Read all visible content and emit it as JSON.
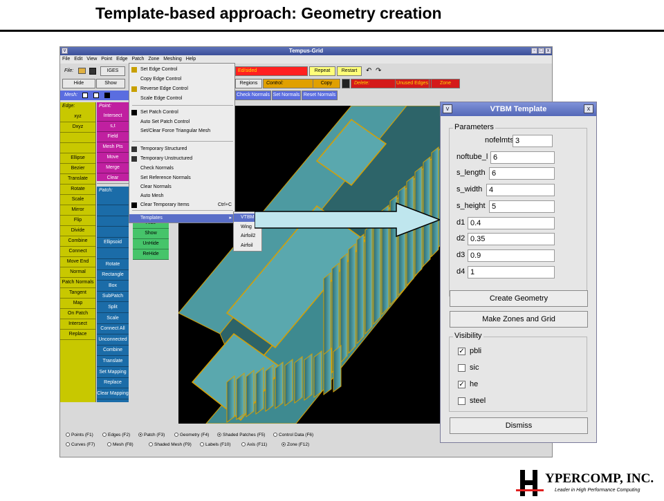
{
  "slide_title": "Template-based approach: Geometry creation",
  "app": {
    "window_title": "Tempus-Grid",
    "menus": [
      "File",
      "Edit",
      "View",
      "Point",
      "Edge",
      "Patch",
      "Zone",
      "Meshing",
      "Help"
    ],
    "file_label": "File:",
    "iges": "IGES",
    "hide": "Hide",
    "show": "Show",
    "mesh_label": "Mesh:",
    "regions": "Regions",
    "control_label": "Control:",
    "copy": "Copy",
    "delete_label": "Delete:",
    "unused_edges": "Unused Edges",
    "zone": "Zone",
    "repeat": "Repeat",
    "restart": "Restart",
    "status_text": "Ed/sided",
    "check_normals": "Check Normals",
    "set_normals": "Set Normals",
    "reset_normals": "Reset Normals",
    "edge_label": "Edge:",
    "edge_items": [
      "xyz",
      "Dxyz",
      "",
      "",
      "Ellipse",
      "Bezier",
      "Translate",
      "Rotate",
      "Scale",
      "Mirror",
      "Flip",
      "Divide",
      "Combine",
      "Connect",
      "Move End",
      "Normal",
      "Patch Normals",
      "Tangent",
      "Map",
      "On Patch",
      "Intersect",
      "Replace"
    ],
    "point_label": "Point:",
    "point_items": [
      "Intersect",
      "s,t",
      "Field",
      "Mesh Pts",
      "Move",
      "Merge",
      "Clear"
    ],
    "patch_label": "Patch:",
    "patch_items": [
      "",
      "",
      "",
      "",
      "Ellipsoid",
      "",
      "Rotate",
      "Rectangle",
      "Box",
      "SubPatch",
      "Split",
      "Scale",
      "Connect All",
      "Unconnected",
      "Combine",
      "Translate",
      "Set Mapping",
      "Replace",
      "Clear Mapping"
    ],
    "green_items": [
      "Hide",
      "Show",
      "UnHide",
      "ReHide"
    ],
    "status_row1": [
      "Points (F1)",
      "Edges (F2)",
      "Patch (F3)",
      "Geometry (F4)",
      "Shaded Patches (F5)",
      "Control Data (F6)"
    ],
    "status_row2": [
      "Curves (F7)",
      "Mesh (F8)",
      "Shaded Mesh (F9)",
      "Labels (F10)",
      "Axis (F11)",
      "Zone (F12)"
    ]
  },
  "patch_menu": {
    "items": [
      "Set Edge Control",
      "Copy Edge Control",
      "Reverse Edge Control",
      "Scale Edge Control",
      "Set Patch Control",
      "Auto Set Patch Control",
      "Set/Clear Force Triangular Mesh",
      "Temporary Structured",
      "Temporary Unstructured",
      "Check Normals",
      "Set Reference Normals",
      "Clear Normals",
      "Auto Mesh",
      "Clear Temporary Items",
      "Templates"
    ],
    "shortcut": "Ctrl+C",
    "submenu": [
      "VTBM",
      "Wing",
      "Airfoil2",
      "Airfoil"
    ]
  },
  "dialog": {
    "title": "VTBM Template",
    "parameters_label": "Parameters",
    "params": [
      {
        "label": "nofelmts",
        "value": "3"
      },
      {
        "label": "noftube_l",
        "value": "6"
      },
      {
        "label": "s_length",
        "value": "6"
      },
      {
        "label": "s_width",
        "value": "4"
      },
      {
        "label": "s_height",
        "value": "5"
      },
      {
        "label": "d1",
        "value": "0.4"
      },
      {
        "label": "d2",
        "value": "0.35"
      },
      {
        "label": "d3",
        "value": "0.9"
      },
      {
        "label": "d4",
        "value": "1"
      }
    ],
    "create_geometry": "Create Geometry",
    "make_zones": "Make Zones and Grid",
    "visibility_label": "Visibility",
    "visibility": [
      {
        "label": "pbli",
        "checked": true
      },
      {
        "label": "sic",
        "checked": false
      },
      {
        "label": "he",
        "checked": true
      },
      {
        "label": "steel",
        "checked": false
      }
    ],
    "dismiss": "Dismiss"
  },
  "logo": {
    "brand": "YPERCOMP, INC.",
    "letter": "H",
    "tagline": "Leader in High Performance Computing"
  },
  "colors": {
    "accent": "#5a6de0",
    "geometry": "#4fa0a8",
    "arrow": "#bfe6ee"
  }
}
